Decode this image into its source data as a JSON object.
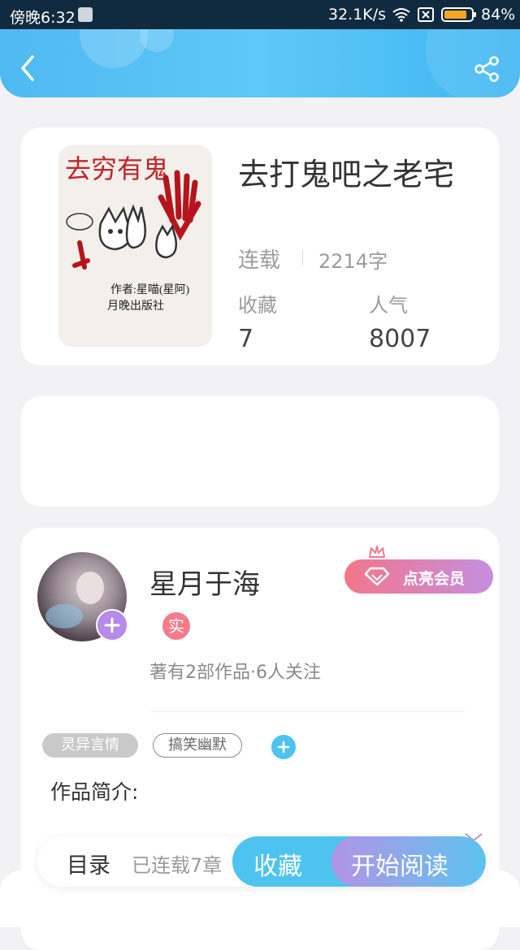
{
  "status_bar": {
    "time": "傍晚6:32",
    "speed": "32.1K/s",
    "battery": "84%"
  },
  "book": {
    "title": "去打鬼吧之老宅",
    "status": "连载",
    "word_count": "2214字",
    "favorites_label": "收藏",
    "favorites_value": "7",
    "popularity_label": "人气",
    "popularity_value": "8007",
    "cover_text": {
      "title": "去穷有鬼",
      "author_line": "作者:星喵(星阿)",
      "publisher_line": "月晚出版社"
    }
  },
  "author": {
    "name": "星月于海",
    "verified_badge": "实",
    "stats": "著有2部作品·6人关注",
    "vip_button": "点亮会员"
  },
  "tags": [
    "灵异言情",
    "搞笑幽默"
  ],
  "synopsis_label": "作品简介:",
  "bottom_bar": {
    "catalog_label": "目录",
    "chapters_text": "已连载7章",
    "favorite_button": "收藏",
    "read_button": "开始阅读"
  },
  "colors": {
    "header": "#4fb9f2",
    "accent_blue": "#4fc3f0",
    "accent_purple": "#b294e6",
    "vip_pink": "#f2778a"
  }
}
